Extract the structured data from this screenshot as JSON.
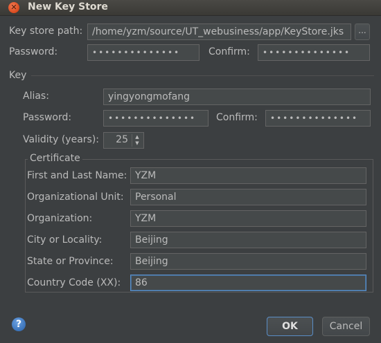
{
  "window": {
    "title": "New Key Store"
  },
  "keystore": {
    "path_label": "Key store path:",
    "path_value": "/home/yzm/source/UT_webusiness/app/KeyStore.jks",
    "browse_label": "...",
    "password_label": "Password:",
    "password_value": "••••••••••••••",
    "confirm_label": "Confirm:",
    "confirm_value": "••••••••••••••"
  },
  "key": {
    "section_label": "Key",
    "alias_label": "Alias:",
    "alias_value": "yingyongmofang",
    "password_label": "Password:",
    "password_value": "••••••••••••••",
    "confirm_label": "Confirm:",
    "confirm_value": "••••••••••••••",
    "validity_label": "Validity (years):",
    "validity_value": "25"
  },
  "certificate": {
    "section_label": "Certificate",
    "fields": [
      {
        "label": "First and Last Name:",
        "value": "YZM"
      },
      {
        "label": "Organizational Unit:",
        "value": "Personal"
      },
      {
        "label": "Organization:",
        "value": "YZM"
      },
      {
        "label": "City or Locality:",
        "value": "Beijing"
      },
      {
        "label": "State or Province:",
        "value": "Beijing"
      },
      {
        "label": "Country Code (XX):",
        "value": "86"
      }
    ]
  },
  "buttons": {
    "ok": "OK",
    "cancel": "Cancel",
    "help": "?"
  },
  "colors": {
    "background": "#3c3f41",
    "field": "#45494a",
    "focus": "#5a8ec7",
    "text": "#bbbbbb"
  }
}
